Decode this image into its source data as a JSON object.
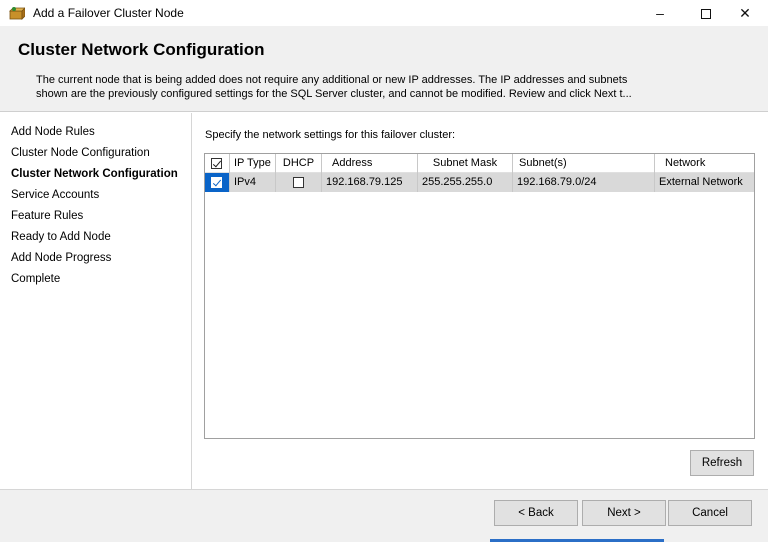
{
  "window": {
    "title": "Add a Failover Cluster Node",
    "minimize": "–",
    "close": "✕"
  },
  "header": {
    "title": "Cluster Network Configuration",
    "description_line1": "The current node that is being added does not require any additional or new IP addresses.  The IP addresses and subnets",
    "description_line2": "shown are the previously configured settings for the SQL Server cluster, and cannot be modified. Review and click Next t..."
  },
  "sidebar": {
    "items": [
      {
        "label": "Add Node Rules",
        "active": false
      },
      {
        "label": "Cluster Node Configuration",
        "active": false
      },
      {
        "label": "Cluster Network Configuration",
        "active": true
      },
      {
        "label": "Service Accounts",
        "active": false
      },
      {
        "label": "Feature Rules",
        "active": false
      },
      {
        "label": "Ready to Add Node",
        "active": false
      },
      {
        "label": "Add Node Progress",
        "active": false
      },
      {
        "label": "Complete",
        "active": false
      }
    ]
  },
  "content": {
    "instruction": "Specify the network settings for this failover cluster:",
    "grid": {
      "columns": [
        "IP Type",
        "DHCP",
        "Address",
        "Subnet Mask",
        "Subnet(s)",
        "Network"
      ],
      "header_checked": true,
      "rows": [
        {
          "selected": true,
          "checked": true,
          "ip_type": "IPv4",
          "dhcp": false,
          "address": "192.168.79.125",
          "subnet_mask": "255.255.255.0",
          "subnets": "192.168.79.0/24",
          "network": "External Network"
        }
      ]
    },
    "refresh_label": "Refresh"
  },
  "footer": {
    "back_label": "< Back",
    "next_label": "Next >",
    "cancel_label": "Cancel"
  },
  "colors": {
    "selection": "#0a64c8",
    "header_bg": "#f0f0f0",
    "row_selected_bg": "#d9d9d9"
  }
}
